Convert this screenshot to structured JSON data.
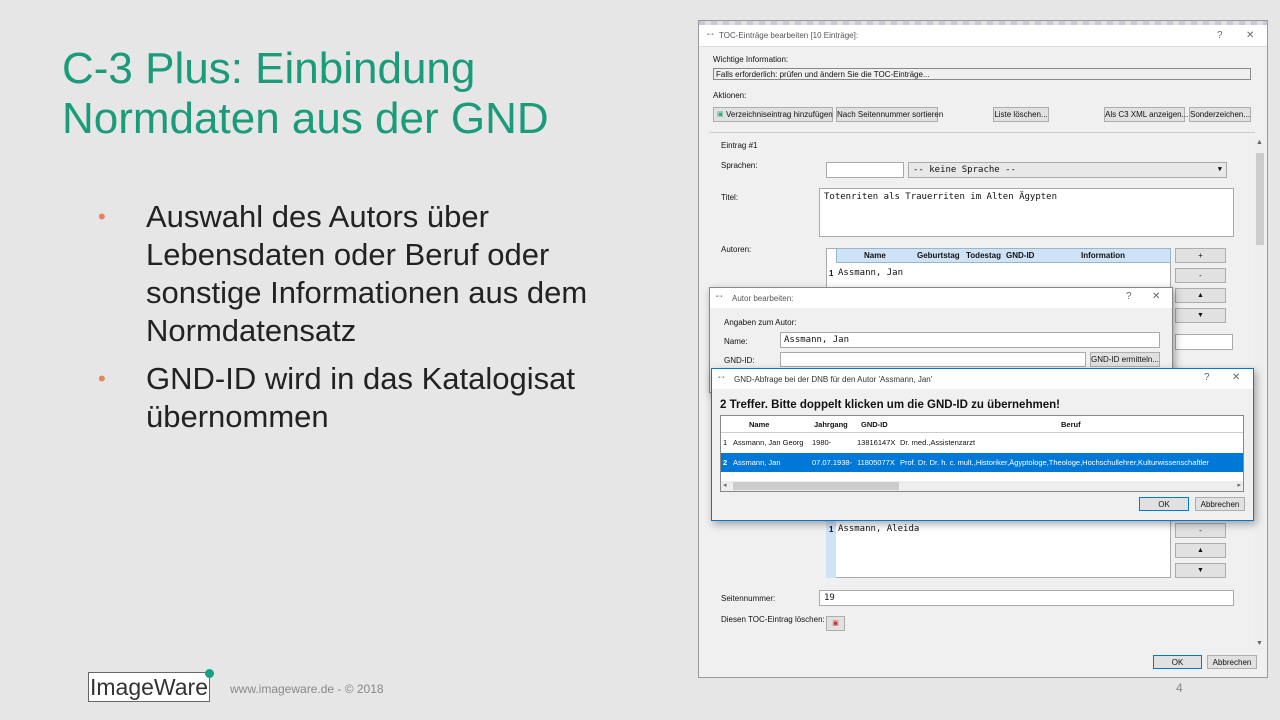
{
  "slide": {
    "title": "C-3 Plus: Einbindung Normdaten aus der GND",
    "bullets": [
      "Auswahl des Autors über Lebensdaten oder Beruf oder sonstige Informationen aus dem Normdatensatz",
      "GND-ID wird in das Katalogisat übernommen"
    ],
    "logo": "ImageWare",
    "footer": "www.imageware.de - © 2018",
    "page_number": "4"
  },
  "toc_window": {
    "title": "TOC-Einträge bearbeiten [10 Einträge]:",
    "help": "?",
    "close": "✕",
    "info_label": "Wichtige Information:",
    "info_text": "Falls erforderlich: prüfen und ändern Sie die TOC-Einträge...",
    "actions_label": "Aktionen:",
    "actions": [
      "Verzeichniseintrag hinzufügen",
      "Nach Seitennummer sortieren",
      "Liste löschen...",
      "Als C3 XML anzeigen...",
      "Sonderzeichen..."
    ],
    "entry_label": "Eintrag #1",
    "languages_label": "Sprachen:",
    "language_value": "-- keine Sprache --",
    "title_label": "Titel:",
    "title_value": "Totenriten als Trauerriten im Alten Ägypten",
    "authors_label": "Autoren:",
    "author_columns": [
      "Name",
      "Geburtstag",
      "Todestag",
      "GND-ID",
      "Information"
    ],
    "author_row_index": "1",
    "author_row_name": "Assmann, Jan",
    "second_row_index": "1",
    "second_row_name": "Assmann, Aleida",
    "side_buttons": [
      "+",
      "-",
      "▲",
      "▼"
    ],
    "lower_buttons": [
      "-",
      "▲",
      "▼"
    ],
    "page_label": "Seitennummer:",
    "page_value": "19",
    "delete_label": "Diesen TOC-Eintrag löschen:",
    "ok": "OK",
    "cancel": "Abbrechen"
  },
  "author_dialog": {
    "title": "Autor bearbeiten:",
    "help": "?",
    "close": "✕",
    "group_label": "Angaben zum Autor:",
    "name_label": "Name:",
    "name_value": "Assmann, Jan",
    "gnd_label": "GND-ID:",
    "gnd_value": "",
    "gnd_button": "GND-ID ermitteln..."
  },
  "gnd_dialog": {
    "title": "GND-Abfrage bei der DNB für den Autor 'Assmann, Jan'",
    "help": "?",
    "close": "✕",
    "heading": "2 Treffer. Bitte doppelt klicken um die GND-ID zu übernehmen!",
    "columns": [
      "Name",
      "Jahrgang",
      "GND-ID",
      "Beruf"
    ],
    "rows": [
      {
        "index": "1",
        "name": "Assmann, Jan Georg",
        "year": "1980-",
        "gnd": "13816147X",
        "job": "Dr. med.,Assistenzarzt"
      },
      {
        "index": "2",
        "name": "Assmann, Jan",
        "year": "07.07.1938-",
        "gnd": "11805077X",
        "job": "Prof. Dr. Dr. h. c. mult.,Historiker,Ägyptologe,Theologe,Hochschullehrer,Kulturwissenschaftler"
      }
    ],
    "ok": "OK",
    "cancel": "Abbrechen"
  },
  "colors": {
    "title_green": "#1a9b7a",
    "bullet_orange": "#e8845a",
    "select_blue": "#0078d7"
  }
}
